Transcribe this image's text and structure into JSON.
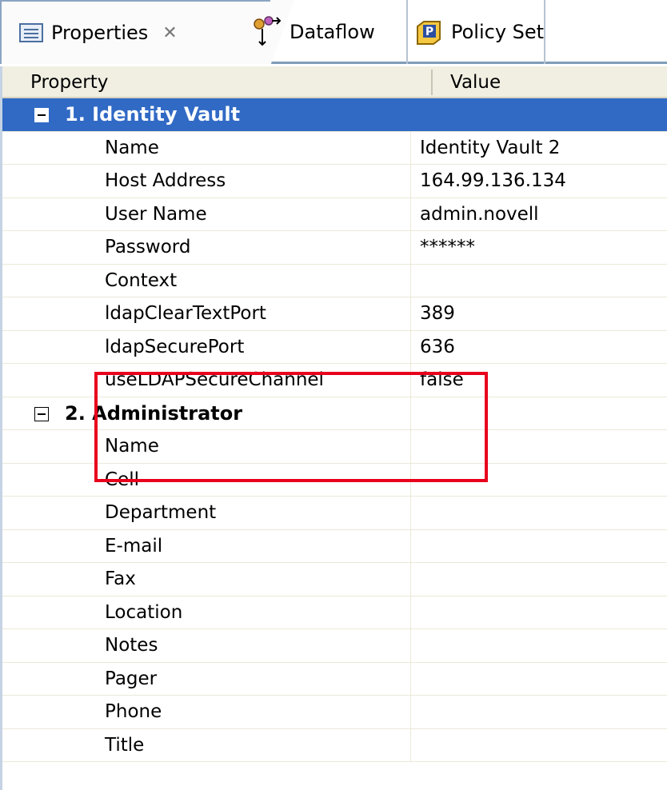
{
  "tabs": [
    {
      "label": "Properties",
      "icon": "properties-icon",
      "active": true,
      "close_glyph": "✕"
    },
    {
      "label": "Dataflow",
      "icon": "dataflow-icon",
      "active": false
    },
    {
      "label": "Policy Set",
      "icon": "policy-set-icon",
      "active": false
    }
  ],
  "table": {
    "headers": {
      "property": "Property",
      "value": "Value"
    },
    "categories": [
      {
        "label": "1. Identity Vault",
        "selected": true,
        "rows": [
          {
            "property": "Name",
            "value": "Identity Vault 2"
          },
          {
            "property": "Host Address",
            "value": "164.99.136.134"
          },
          {
            "property": "User Name",
            "value": "admin.novell"
          },
          {
            "property": "Password",
            "value": "******"
          },
          {
            "property": "Context",
            "value": ""
          },
          {
            "property": "ldapClearTextPort",
            "value": "389"
          },
          {
            "property": "ldapSecurePort",
            "value": "636"
          },
          {
            "property": "useLDAPSecureChannel",
            "value": "false"
          }
        ]
      },
      {
        "label": "2. Administrator",
        "selected": false,
        "rows": [
          {
            "property": "Name",
            "value": ""
          },
          {
            "property": "Cell",
            "value": ""
          },
          {
            "property": "Department",
            "value": ""
          },
          {
            "property": "E-mail",
            "value": ""
          },
          {
            "property": "Fax",
            "value": ""
          },
          {
            "property": "Location",
            "value": ""
          },
          {
            "property": "Notes",
            "value": ""
          },
          {
            "property": "Pager",
            "value": ""
          },
          {
            "property": "Phone",
            "value": ""
          },
          {
            "property": "Title",
            "value": ""
          }
        ]
      }
    ]
  },
  "colors": {
    "selection": "#316ac5",
    "highlight_box": "#e8001c",
    "header_bg": "#f1efe2"
  }
}
